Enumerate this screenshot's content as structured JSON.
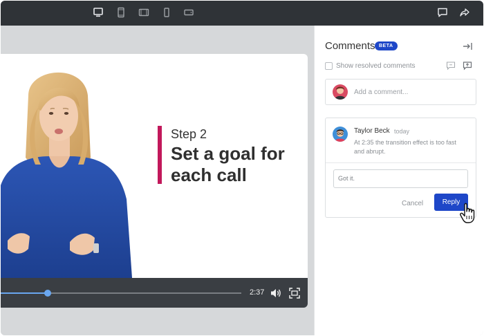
{
  "slide": {
    "step": "Step 2",
    "title": "Set a goal for each call"
  },
  "player": {
    "time": "2:37",
    "progress": 0.195
  },
  "toolbar": {
    "device_icons": [
      "desktop-icon",
      "tablet-portrait-icon",
      "tablet-landscape-icon",
      "phone-portrait-icon",
      "phone-landscape-icon"
    ],
    "right_icons": [
      "comment-icon",
      "share-icon"
    ]
  },
  "comments": {
    "title": "Comments",
    "badge": "BETA",
    "show_resolved": "Show resolved comments",
    "add_placeholder": "Add a comment...",
    "thread": {
      "author": "Taylor Beck",
      "time": "today",
      "text": "At 2:35 the transition effect is too fast and abrupt.",
      "reply_value": "Got it.",
      "cancel_label": "Cancel",
      "reply_label": "Reply"
    }
  },
  "colors": {
    "accent": "#c2185b",
    "primary": "#1e47c8",
    "progress": "#6aa7f0",
    "topbar": "#2f3337"
  }
}
